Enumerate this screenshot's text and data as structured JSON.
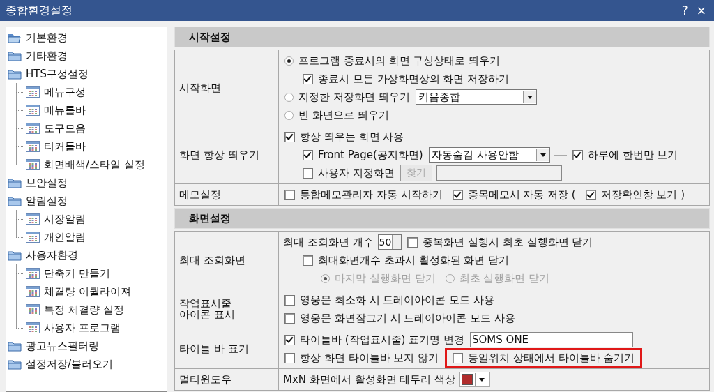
{
  "window": {
    "title": "종합환경설정",
    "help": "?",
    "close": "×"
  },
  "tree": [
    {
      "label": "기본환경",
      "kind": "folder",
      "expanded": true
    },
    {
      "label": "기타환경",
      "kind": "folder"
    },
    {
      "label": "HTS구성설정",
      "kind": "folder",
      "children": [
        {
          "label": "메뉴구성",
          "kind": "page"
        },
        {
          "label": "메뉴툴바",
          "kind": "page"
        },
        {
          "label": "도구모음",
          "kind": "page"
        },
        {
          "label": "티커툴바",
          "kind": "page"
        },
        {
          "label": "화면배색/스타일 설정",
          "kind": "page"
        }
      ]
    },
    {
      "label": "보안설정",
      "kind": "folder"
    },
    {
      "label": "알림설정",
      "kind": "folder",
      "children": [
        {
          "label": "시장알림",
          "kind": "page"
        },
        {
          "label": "개인알림",
          "kind": "page"
        }
      ]
    },
    {
      "label": "사용자환경",
      "kind": "folder",
      "children": [
        {
          "label": "단축키 만들기",
          "kind": "page"
        },
        {
          "label": "체결량 이퀄라이져",
          "kind": "page"
        },
        {
          "label": "특정 체결량 설정",
          "kind": "page"
        },
        {
          "label": "사용자 프로그램",
          "kind": "page"
        }
      ]
    },
    {
      "label": "광고뉴스필터링",
      "kind": "folder"
    },
    {
      "label": "설정저장/불러오기",
      "kind": "folder"
    }
  ],
  "sections": [
    {
      "title": "시작설정",
      "rows": [
        {
          "label": "시작화면",
          "lines": [
            {
              "items": [
                {
                  "kind": "radio",
                  "label": "프로그램 종료시의 화면 구성상태로 띄우기",
                  "selected": true
                }
              ],
              "children": [
                {
                  "items": [
                    {
                      "kind": "checkbox",
                      "label": "종료시 모든 가상화면상의 화면 저장하기",
                      "checked": true
                    }
                  ]
                }
              ]
            },
            {
              "items": [
                {
                  "kind": "radio",
                  "label": "지정한 저장화면 띄우기",
                  "selected": false
                },
                {
                  "kind": "dropdown",
                  "value": "키움종합"
                }
              ]
            },
            {
              "items": [
                {
                  "kind": "radio",
                  "label": "빈 화면으로 띄우기",
                  "selected": false
                }
              ]
            }
          ]
        },
        {
          "label": "화면 항상 띄우기",
          "lines": [
            {
              "items": [
                {
                  "kind": "checkbox",
                  "label": "항상 띄우는 화면 사용",
                  "checked": true
                }
              ],
              "children": [
                {
                  "items": [
                    {
                      "kind": "checkbox",
                      "label": "Front Page(공지화면)",
                      "checked": true
                    },
                    {
                      "kind": "dropdown",
                      "value": "자동숨김 사용안함"
                    },
                    {
                      "kind": "dash"
                    },
                    {
                      "kind": "checkbox",
                      "label": "하루에 한번만 보기",
                      "checked": true
                    }
                  ]
                },
                {
                  "items": [
                    {
                      "kind": "checkbox",
                      "label": "사용자 지정화면",
                      "checked": false
                    },
                    {
                      "kind": "button",
                      "label": "찾기",
                      "disabled": true
                    },
                    {
                      "kind": "input",
                      "disabled": true
                    }
                  ]
                }
              ]
            }
          ]
        },
        {
          "label": "메모설정",
          "lines": [
            {
              "items": [
                {
                  "kind": "checkbox",
                  "label": "통합메모관리자 자동 시작하기",
                  "checked": false
                },
                {
                  "kind": "checkbox",
                  "label": "종목메모시 자동 저장 (",
                  "checked": true
                },
                {
                  "kind": "checkbox",
                  "label": "저장확인창 보기 )",
                  "checked": true
                }
              ]
            }
          ]
        }
      ]
    },
    {
      "title": "화면설정",
      "rows": [
        {
          "label": "최대 조회화면",
          "lines": [
            {
              "items": [
                {
                  "kind": "text",
                  "label": "최대 조회화면 개수"
                },
                {
                  "kind": "spinner",
                  "value": "50"
                },
                {
                  "kind": "checkbox",
                  "label": "중복화면 실행시 최초 실행화면 닫기",
                  "checked": false
                }
              ],
              "children": [
                {
                  "items": [
                    {
                      "kind": "checkbox",
                      "label": "최대화면개수 초과시 활성화된 화면 닫기",
                      "checked": false
                    }
                  ],
                  "children": [
                    {
                      "items": [
                        {
                          "kind": "radio",
                          "label": "마지막 실행화면 닫기",
                          "selected": true,
                          "disabled": true
                        },
                        {
                          "kind": "radio",
                          "label": "최초 실행화면 닫기",
                          "selected": false,
                          "disabled": true
                        }
                      ]
                    }
                  ]
                }
              ]
            }
          ]
        },
        {
          "label": "작업표시줄\n아이콘 표시",
          "lines": [
            {
              "items": [
                {
                  "kind": "checkbox",
                  "label": "영웅문 최소화 시 트레이아이콘 모드 사용",
                  "checked": false
                }
              ]
            },
            {
              "items": [
                {
                  "kind": "checkbox",
                  "label": "영웅문 화면잠그기 시 트레이아이콘 모드 사용",
                  "checked": false
                }
              ]
            }
          ]
        },
        {
          "label": "타이틀 바 표기",
          "lines": [
            {
              "items": [
                {
                  "kind": "checkbox",
                  "label": "타이틀바 (작업표시줄) 표기명 변경",
                  "checked": true
                },
                {
                  "kind": "input",
                  "value": "SOMS ONE"
                }
              ]
            },
            {
              "items": [
                {
                  "kind": "checkbox",
                  "label": "항상 화면 타이틀바 보지 않기",
                  "checked": false
                },
                {
                  "kind": "checkbox",
                  "label": "동일위치 상태에서 타이틀바 숨기기",
                  "checked": false,
                  "highlighted": true
                }
              ]
            }
          ]
        },
        {
          "label": "멀티윈도우",
          "lines": [
            {
              "items": [
                {
                  "kind": "text",
                  "label": "MxN 화면에서 활성화면 테두리 색상"
                },
                {
                  "kind": "color",
                  "color": "#b02c2c"
                }
              ]
            }
          ]
        }
      ]
    }
  ]
}
